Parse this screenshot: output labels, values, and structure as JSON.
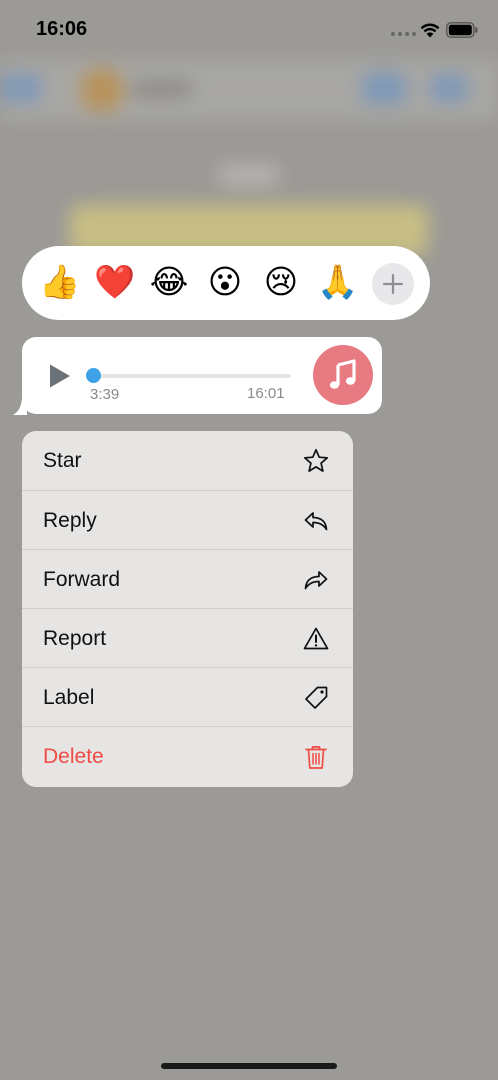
{
  "status_bar": {
    "time": "16:06"
  },
  "reactions": [
    {
      "emoji": "👍",
      "icon": "thumbs-up"
    },
    {
      "emoji": "❤️",
      "icon": "red-heart"
    },
    {
      "emoji": "😂",
      "icon": "face-with-tears-of-joy"
    },
    {
      "emoji": "😮",
      "icon": "face-with-open-mouth"
    },
    {
      "emoji": "😢",
      "icon": "crying-face"
    },
    {
      "emoji": "🙏",
      "icon": "folded-hands"
    }
  ],
  "reaction_more_icon": "plus-icon",
  "audio_message": {
    "duration": "3:39",
    "time": "16:01",
    "progress": 0,
    "accent_color": "#3fa2e8",
    "avatar_color": "#e87a82",
    "avatar_icon": "music-note-icon"
  },
  "menu": {
    "items": [
      {
        "label": "Star",
        "icon": "star-icon"
      },
      {
        "label": "Reply",
        "icon": "reply-icon"
      },
      {
        "label": "Forward",
        "icon": "forward-icon"
      },
      {
        "label": "Report",
        "icon": "warning-icon"
      },
      {
        "label": "Label",
        "icon": "tag-icon"
      },
      {
        "label": "Delete",
        "icon": "trash-icon",
        "color": "#f04b46"
      }
    ]
  }
}
